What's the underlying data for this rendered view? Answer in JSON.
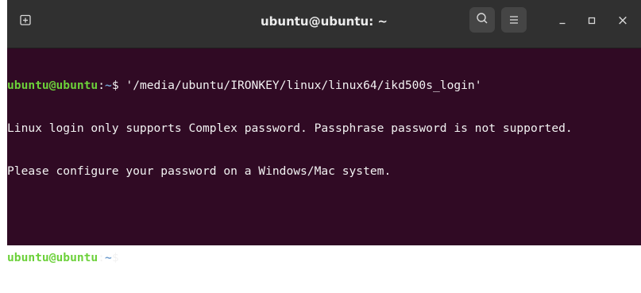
{
  "window": {
    "title": "ubuntu@ubuntu: ~"
  },
  "header": {
    "new_tab_icon": "new-tab-icon",
    "search_icon": "search-icon",
    "menu_icon": "hamburger-menu-icon",
    "minimize_icon": "minimize-icon",
    "maximize_icon": "maximize-icon",
    "close_icon": "close-icon",
    "close_glyph": "×"
  },
  "terminal": {
    "lines": [
      {
        "user_host": "ubuntu@ubuntu",
        "colon": ":",
        "path": "~",
        "prompt_char": "$",
        "command": " '/media/ubuntu/IRONKEY/linux/linux64/ikd500s_login'"
      },
      {
        "text": "Linux login only supports Complex password. Passphrase password is not supported."
      },
      {
        "text": "Please configure your password on a Windows/Mac system."
      },
      {
        "text": ""
      },
      {
        "user_host": "ubuntu@ubuntu",
        "colon": ":",
        "path": "~",
        "prompt_char": "$",
        "command": " "
      }
    ]
  },
  "colors": {
    "terminal_background": "#300a24",
    "titlebar_background": "#303030",
    "prompt_user": "#6cd13a",
    "prompt_path": "#729fcf",
    "text": "#f2f2f2"
  }
}
